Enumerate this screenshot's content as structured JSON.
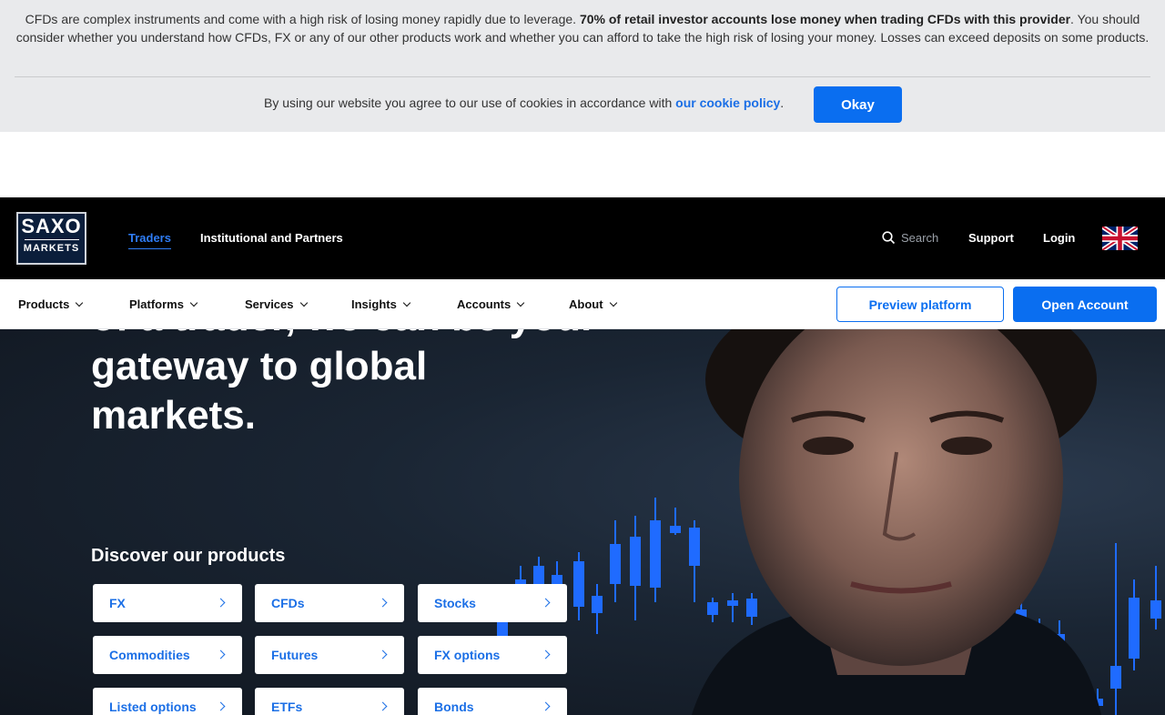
{
  "banner": {
    "risk_text_start": "CFDs are complex instruments and come with a high risk of losing money rapidly due to leverage. ",
    "risk_text_bold": "70% of retail investor accounts lose money when trading CFDs with this provider",
    "risk_text_end": ". You should consider whether you understand how CFDs, FX or any of our other products work and whether you can afford to take the high risk of losing your money. Losses can exceed deposits on some products.",
    "cookie_text": "By using our website you agree to our use of cookies in accordance with ",
    "cookie_link": "our cookie policy",
    "cookie_period": ".",
    "okay_label": "Okay"
  },
  "topnav": {
    "logo_top": "SAXO",
    "logo_bottom": "MARKETS",
    "links": [
      "Traders",
      "Institutional and Partners"
    ],
    "search_label": "Search",
    "support_label": "Support",
    "login_label": "Login",
    "flag_icon": "uk-flag-icon"
  },
  "subnav": {
    "items": [
      "Products",
      "Platforms",
      "Services",
      "Insights",
      "Accounts",
      "About"
    ],
    "preview_label": "Preview platform",
    "open_label": "Open Account"
  },
  "hero": {
    "heading": "of a trader, we can be your gateway to global markets.",
    "discover_title": "Discover our products",
    "products": [
      "FX",
      "CFDs",
      "Stocks",
      "Commodities",
      "Futures",
      "FX options",
      "Listed options",
      "ETFs",
      "Bonds"
    ]
  },
  "colors": {
    "accent": "#0a6ef0",
    "link": "#1b6fe6",
    "nav_bg": "#000000",
    "banner_bg": "#e9eaec",
    "candle": "#1f6bff"
  }
}
